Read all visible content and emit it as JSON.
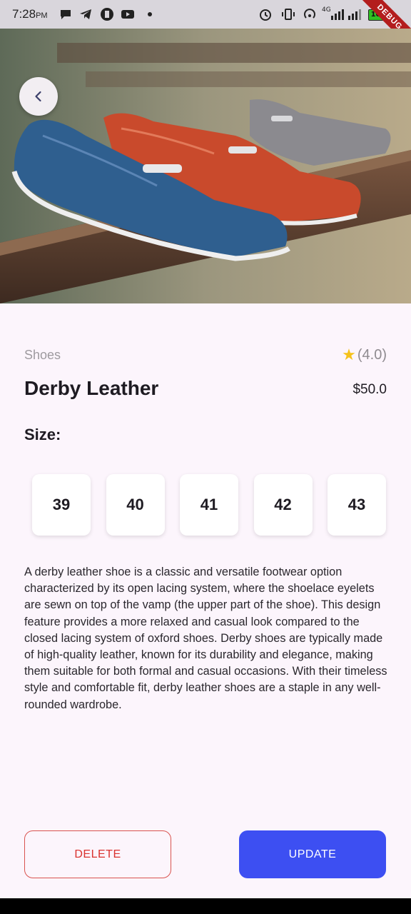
{
  "status_bar": {
    "time": "7:28",
    "ampm": "PM",
    "network": "4G",
    "battery": "100",
    "debug_label": "DEBUG"
  },
  "product": {
    "category": "Shoes",
    "rating": "(4.0)",
    "name": "Derby Leather",
    "price": "$50.0",
    "size_label": "Size:",
    "sizes": [
      "39",
      "40",
      "41",
      "42",
      "43"
    ],
    "description": "A derby leather shoe is a classic and versatile footwear option characterized by its open lacing system, where the shoelace eyelets are sewn on top of the vamp (the upper part of the shoe). This design feature provides a more relaxed and casual look compared to the closed lacing system of oxford shoes. Derby shoes are typically made of high-quality leather, known for its durability and elegance, making them suitable for both formal and casual occasions. With their timeless style and comfortable fit, derby leather shoes are a staple in any well-rounded wardrobe."
  },
  "actions": {
    "delete_label": "DELETE",
    "update_label": "UPDATE"
  },
  "colors": {
    "background": "#fcf5fc",
    "delete": "#d9322e",
    "update": "#3d4ff2",
    "star": "#f5c21b"
  },
  "icons": {
    "back": "chevron-left-icon",
    "rating": "star-icon"
  }
}
